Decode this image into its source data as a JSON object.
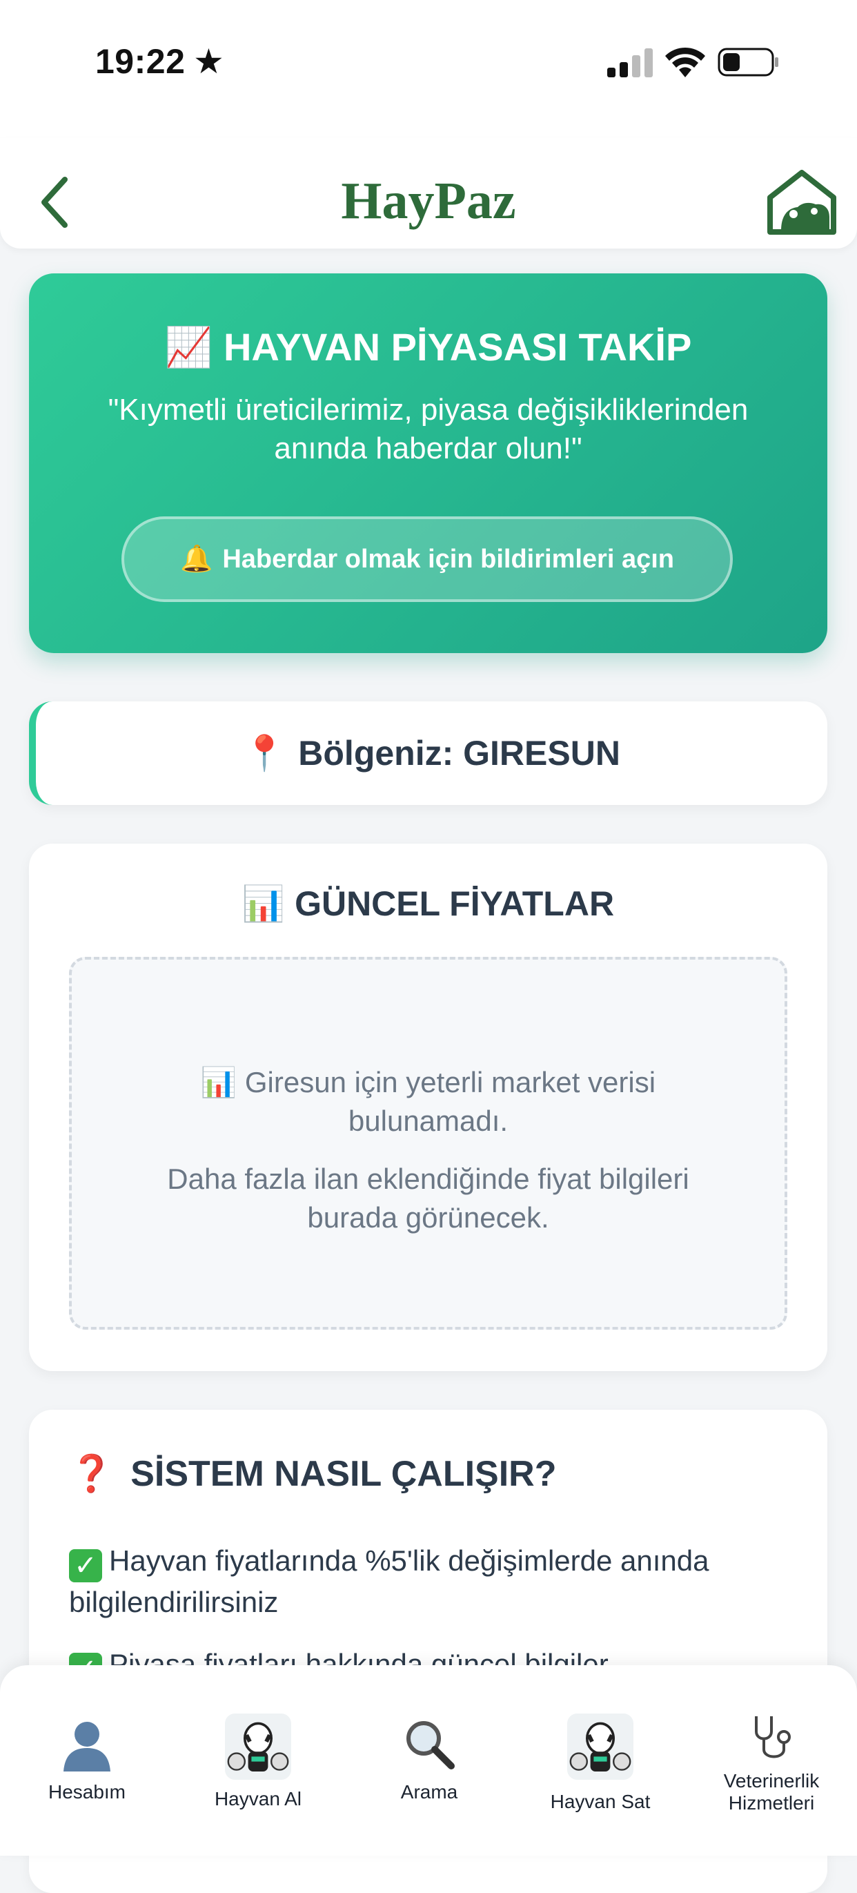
{
  "status_bar": {
    "time": "19:22",
    "star": "★"
  },
  "header": {
    "title": "HayPaz"
  },
  "hero": {
    "icon": "📈",
    "title": "HAYVAN PİYASASI TAKİP",
    "subtitle": "\"Kıymetli üreticilerimiz, piyasa değişikliklerinden anında haberdar olun!\"",
    "button_icon": "🔔",
    "button_label": "Haberdar olmak için bildirimleri açın"
  },
  "region": {
    "icon": "📍",
    "label": "Bölgeniz: GIRESUN"
  },
  "prices": {
    "icon": "📊",
    "title": "GÜNCEL FİYATLAR",
    "empty_icon": "📊",
    "empty_line1": "Giresun için yeterli market verisi bulunamadı.",
    "empty_line2": "Daha fazla ilan eklendiğinde fiyat bilgileri burada görünecek."
  },
  "how": {
    "icon": "❓",
    "title": "SİSTEM NASIL ÇALIŞIR?",
    "items": [
      "Hayvan fiyatlarında %5'lik değişimlerde anında bilgilendirilirsiniz",
      "Piyasa fiyatları hakkında güncel bilgiler"
    ]
  },
  "tabs": [
    {
      "label": "Hesabım",
      "icon": "person-icon"
    },
    {
      "label": "Hayvan Al",
      "icon": "livestock-icon"
    },
    {
      "label": "Arama",
      "icon": "search-icon"
    },
    {
      "label": "Hayvan Sat",
      "icon": "livestock-icon"
    },
    {
      "label": "Veterinerlik Hizmetleri",
      "icon": "stethoscope-icon"
    }
  ]
}
